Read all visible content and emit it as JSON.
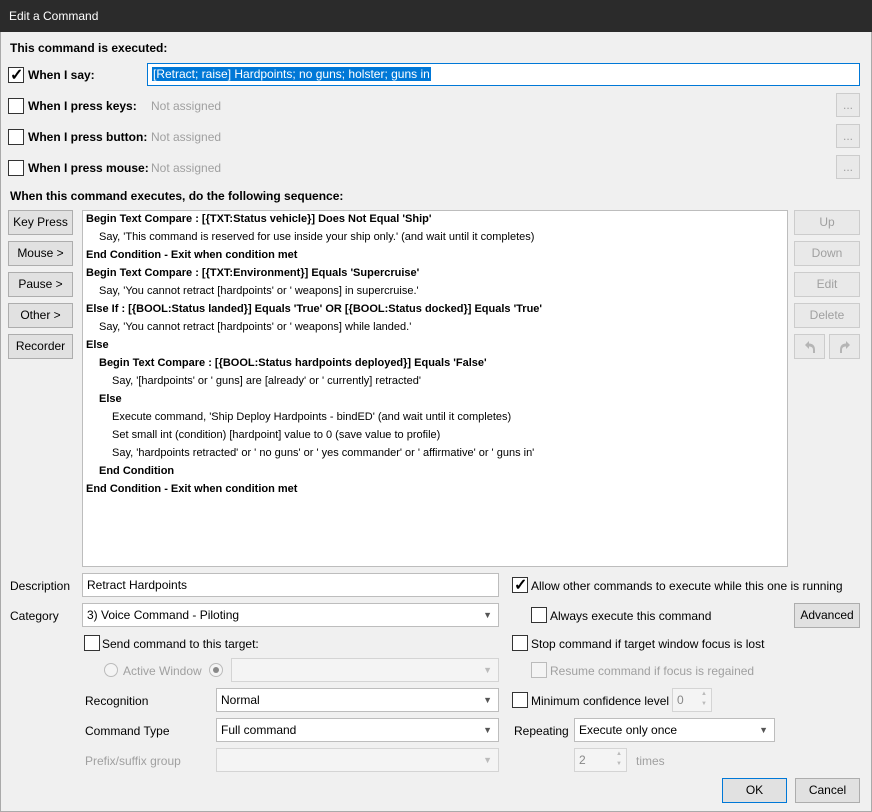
{
  "window": {
    "title": "Edit a Command"
  },
  "triggers": {
    "heading": "This command is executed:",
    "say_label": "When I say:",
    "say_value": "[Retract; raise] Hardpoints; no guns; holster; guns in",
    "keys_label": "When I press keys:",
    "button_label": "When I press button:",
    "mouse_label": "When I press mouse:",
    "not_assigned": "Not assigned",
    "dots": "..."
  },
  "sequence": {
    "heading": "When this command executes, do the following sequence:",
    "left_buttons": [
      "Key Press",
      "Mouse >",
      "Pause >",
      "Other >",
      "Recorder"
    ],
    "right_buttons": [
      "Up",
      "Down",
      "Edit",
      "Delete"
    ],
    "undo_icon": "undo-icon",
    "redo_icon": "redo-icon",
    "actions": [
      {
        "text": "Begin Text Compare : [{TXT:Status vehicle}] Does Not Equal 'Ship'",
        "bold": true,
        "indent": 0
      },
      {
        "text": "Say, 'This command is reserved for use inside your ship only.'  (and wait until it completes)",
        "bold": false,
        "indent": 1
      },
      {
        "text": "End Condition - Exit when condition met",
        "bold": true,
        "indent": 0
      },
      {
        "text": "Begin Text Compare : [{TXT:Environment}] Equals 'Supercruise'",
        "bold": true,
        "indent": 0
      },
      {
        "text": "Say, 'You cannot retract [hardpoints' or ' weapons] in supercruise.'",
        "bold": false,
        "indent": 1
      },
      {
        "text": "Else If : [{BOOL:Status landed}] Equals 'True' OR [{BOOL:Status docked}] Equals 'True'",
        "bold": true,
        "indent": 0
      },
      {
        "text": "Say, 'You cannot retract [hardpoints' or ' weapons] while landed.'",
        "bold": false,
        "indent": 1
      },
      {
        "text": "Else",
        "bold": true,
        "indent": 0
      },
      {
        "text": "Begin Text Compare : [{BOOL:Status hardpoints deployed}] Equals 'False'",
        "bold": true,
        "indent": 1
      },
      {
        "text": "Say, '[hardpoints' or ' guns] are [already' or ' currently] retracted'",
        "bold": false,
        "indent": 2
      },
      {
        "text": "Else",
        "bold": true,
        "indent": 1
      },
      {
        "text": "Execute command, 'Ship Deploy Hardpoints - bindED' (and wait until it completes)",
        "bold": false,
        "indent": 2
      },
      {
        "text": "Set small int (condition) [hardpoint] value to 0 (save value to profile)",
        "bold": false,
        "indent": 2
      },
      {
        "text": "Say, 'hardpoints retracted' or ' no guns' or ' yes commander' or ' affirmative' or ' guns in'",
        "bold": false,
        "indent": 2
      },
      {
        "text": "End Condition",
        "bold": true,
        "indent": 1
      },
      {
        "text": "End Condition - Exit when condition met",
        "bold": true,
        "indent": 0
      }
    ]
  },
  "form": {
    "description_label": "Description",
    "description_value": "Retract Hardpoints",
    "category_label": "Category",
    "category_value": "3) Voice Command - Piloting",
    "send_target_label": "Send command to this target:",
    "active_window_label": "Active Window",
    "recognition_label": "Recognition",
    "recognition_value": "Normal",
    "command_type_label": "Command Type",
    "command_type_value": "Full command",
    "prefix_suffix_label": "Prefix/suffix group"
  },
  "options": {
    "allow_other": "Allow other commands to execute while this one is running",
    "always_execute": "Always execute this command",
    "advanced": "Advanced",
    "stop_focus_lost": "Stop command if target window focus is lost",
    "resume_focus": "Resume command if focus is regained",
    "min_confidence": "Minimum confidence level",
    "min_confidence_value": "0",
    "repeating_label": "Repeating",
    "repeating_value": "Execute only once",
    "times_value": "2",
    "times_label": "times"
  },
  "footer": {
    "ok": "OK",
    "cancel": "Cancel"
  },
  "colors": {
    "accent": "#0078d7",
    "titlebar": "#2b2b2b",
    "selection": "#0078d7"
  }
}
